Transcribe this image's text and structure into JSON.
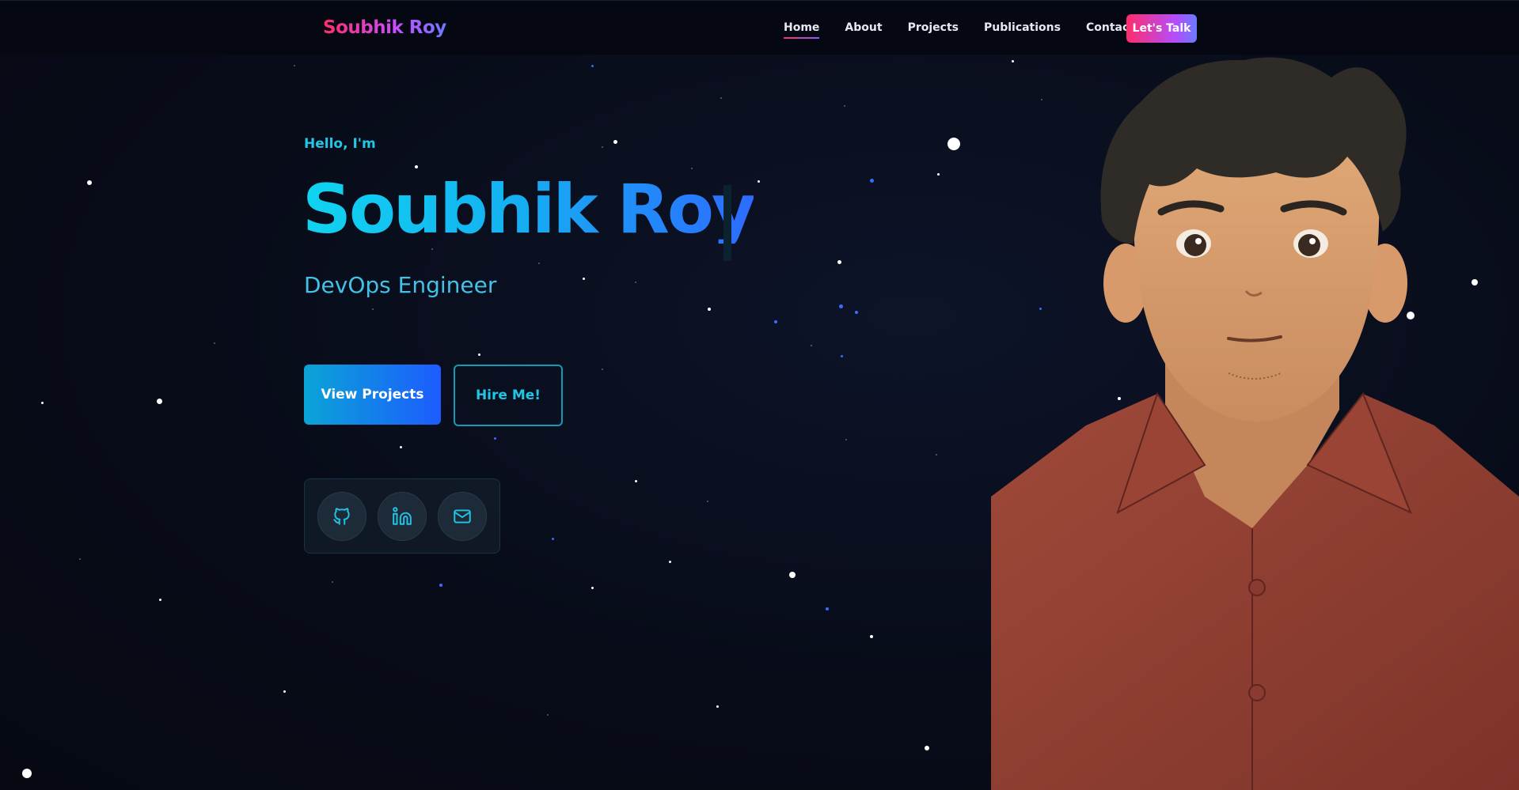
{
  "nav": {
    "logo": "Soubhik Roy",
    "links": [
      "Home",
      "About",
      "Projects",
      "Publications",
      "Contact"
    ],
    "cta": "Let's Talk"
  },
  "hero": {
    "greeting": "Hello, I'm",
    "name": "Soubhik Roy",
    "role": "DevOps Engineer",
    "primary_button": "View Projects",
    "secondary_button": "Hire Me!"
  },
  "socials": [
    {
      "icon": "github-icon"
    },
    {
      "icon": "linkedin-icon"
    },
    {
      "icon": "mail-icon"
    }
  ],
  "colors": {
    "accent_cyan": "#10d4f0",
    "accent_blue": "#2d6bff",
    "accent_pink": "#ff2d6b",
    "background": "#070b16"
  }
}
